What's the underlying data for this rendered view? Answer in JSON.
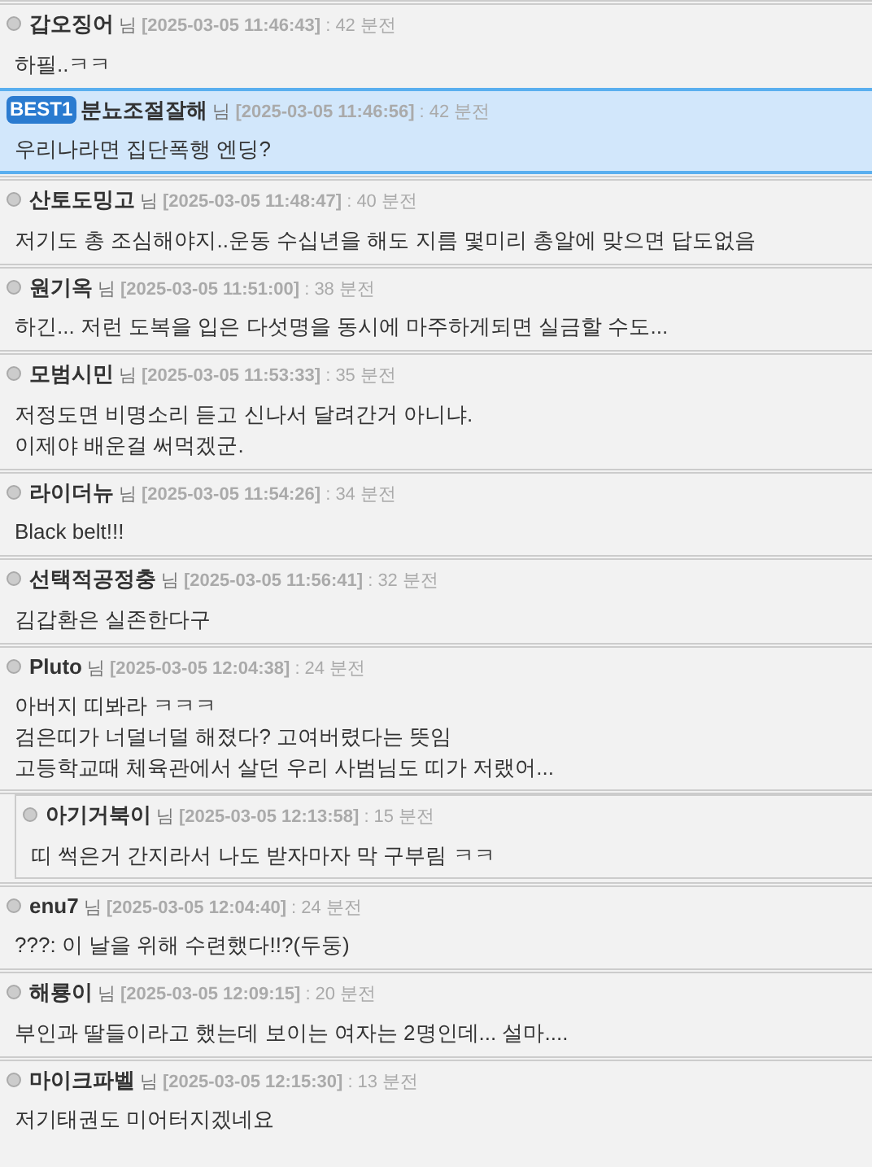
{
  "comments": [
    {
      "kind": "normal",
      "name": "갑오징어",
      "suffix": "님",
      "date": "[2025-03-05 11:46:43]",
      "ago": ": 42 분전",
      "lines": [
        "하필..ㅋㅋ"
      ]
    },
    {
      "kind": "best",
      "badge": "BEST1",
      "name": "분뇨조절잘해",
      "suffix": "님",
      "date": "[2025-03-05 11:46:56]",
      "ago": ": 42 분전",
      "lines": [
        "우리나라면 집단폭행 엔딩?"
      ]
    },
    {
      "kind": "normal",
      "name": "산토도밍고",
      "suffix": "님",
      "date": "[2025-03-05 11:48:47]",
      "ago": ": 40 분전",
      "lines": [
        "저기도 총 조심해야지..운동 수십년을 해도 지름 몇미리 총알에 맞으면 답도없음"
      ]
    },
    {
      "kind": "normal",
      "name": "원기옥",
      "suffix": "님",
      "date": "[2025-03-05 11:51:00]",
      "ago": ": 38 분전",
      "lines": [
        "하긴... 저런 도복을 입은 다섯명을 동시에 마주하게되면 실금할 수도..."
      ]
    },
    {
      "kind": "normal",
      "name": "모범시민",
      "suffix": "님",
      "date": "[2025-03-05 11:53:33]",
      "ago": ": 35 분전",
      "lines": [
        "저정도면 비명소리 듣고 신나서 달려간거 아니냐.",
        "이제야 배운걸 써먹겠군."
      ]
    },
    {
      "kind": "normal",
      "name": "라이더뉴",
      "suffix": "님",
      "date": "[2025-03-05 11:54:26]",
      "ago": ": 34 분전",
      "lines": [
        "Black belt!!!"
      ]
    },
    {
      "kind": "normal",
      "name": "선택적공정충",
      "suffix": "님",
      "date": "[2025-03-05 11:56:41]",
      "ago": ": 32 분전",
      "lines": [
        "김갑환은 실존한다구"
      ]
    },
    {
      "kind": "normal",
      "name": "Pluto",
      "suffix": "님",
      "date": "[2025-03-05 12:04:38]",
      "ago": ": 24 분전",
      "lines": [
        "아버지 띠봐라 ㅋㅋㅋ",
        "검은띠가 너덜너덜 해졌다? 고여버렸다는 뜻임",
        "고등학교때 체육관에서 살던 우리 사범님도 띠가 저랬어..."
      ],
      "children": [
        {
          "name": "아기거북이",
          "suffix": "님",
          "date": "[2025-03-05 12:13:58]",
          "ago": ": 15 분전",
          "lines": [
            "띠 썩은거 간지라서 나도 받자마자 막 구부림 ㅋㅋ"
          ]
        }
      ]
    },
    {
      "kind": "normal",
      "name": "enu7",
      "suffix": "님",
      "date": "[2025-03-05 12:04:40]",
      "ago": ": 24 분전",
      "lines": [
        "???: 이 날을 위해 수련했다!!?(두둥)"
      ]
    },
    {
      "kind": "normal",
      "name": "해룡이",
      "suffix": "님",
      "date": "[2025-03-05 12:09:15]",
      "ago": ": 20 분전",
      "lines": [
        "부인과 딸들이라고 했는데 보이는 여자는 2명인데... 설마...."
      ]
    },
    {
      "kind": "normal",
      "name": "마이크파벨",
      "suffix": "님",
      "date": "[2025-03-05 12:15:30]",
      "ago": ": 13 분전",
      "lines": [
        "저기태권도 미어터지겠네요"
      ]
    }
  ]
}
